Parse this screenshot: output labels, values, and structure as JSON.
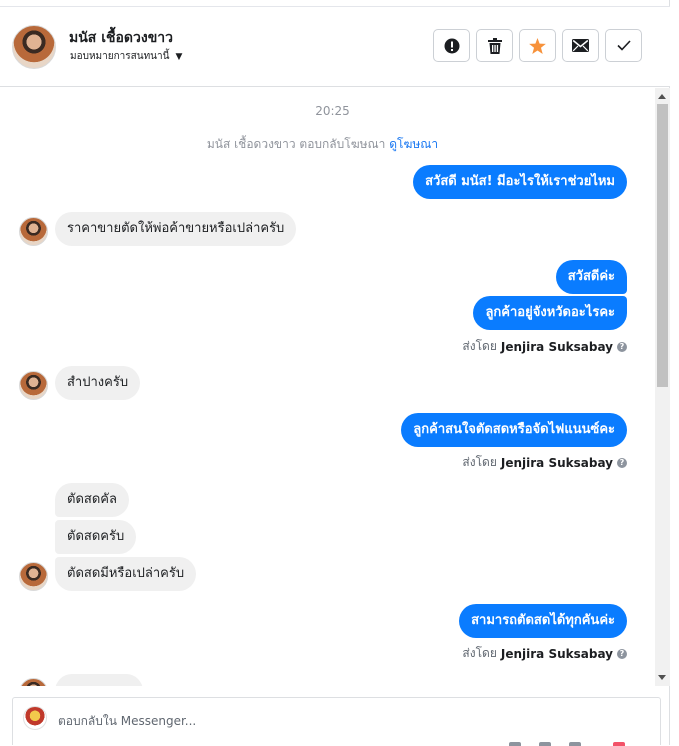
{
  "header": {
    "name": "มนัส เชื้อดวงขาว",
    "assign_label": "มอบหมายการสนทนานี้",
    "buttons": [
      "report-button",
      "delete-button",
      "star-button",
      "mark-unread-button",
      "mark-done-button"
    ],
    "star_color": "#f7923b"
  },
  "thread": {
    "time": "20:25",
    "ad_notice_prefix": "มนัส เชื้อดวงขาว ตอบกลับโฆษณา",
    "ad_notice_link": "ดูโฆษณา",
    "messages": [
      {
        "text": "สวัสดี มนัส! มีอะไรให้เราช่วยไหม"
      },
      {
        "text": "ราคาขายตัดให้พ่อค้าขายหรือเปล่าครับ"
      },
      {
        "text": "สวัสดีค่ะ"
      },
      {
        "text": "ลูกค้าอยู่จังหวัดอะไรคะ"
      },
      {
        "text": "สำปางครับ"
      },
      {
        "text": "ลูกค้าสนใจตัดสดหรือจัดไฟแนนซ์คะ"
      },
      {
        "text": "ตัดสดคัล"
      },
      {
        "text": "ตัดสดครับ"
      },
      {
        "text": "ตัดสดมีหรือเปล่าครับ"
      },
      {
        "text": "สามารถตัดสดได้ทุกคันค่ะ"
      }
    ],
    "sent_by_label": "ส่งโดย",
    "sent_by_name": "Jenjira Suksabay",
    "info_glyph": "?",
    "bubble_out_color": "#0a7cff",
    "bubble_in_color": "#f0f0f0"
  },
  "composer": {
    "placeholder": "ตอบกลับใน Messenger..."
  }
}
